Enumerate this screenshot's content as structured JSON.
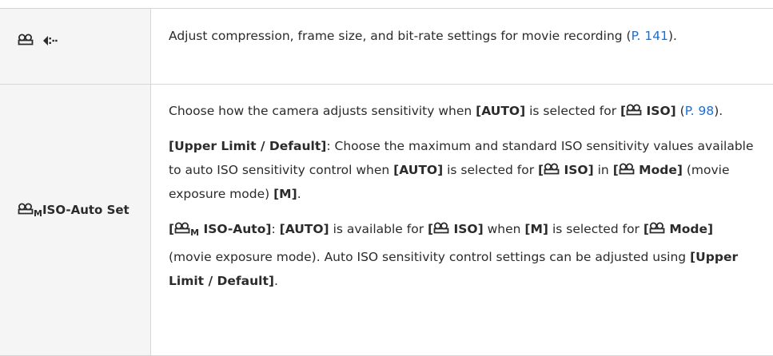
{
  "rows": [
    {
      "label_icons": [
        "movie-icon",
        "compression-icon"
      ],
      "desc_before_link": "Adjust compression, frame size, and bit-rate settings for movie recording (",
      "link": "P. 141",
      "desc_after_link": ")."
    },
    {
      "label_sub": "M",
      "label_text": "ISO-Auto Set",
      "p1": {
        "t1": "Choose how the camera adjusts sensitivity when ",
        "b1": "[AUTO]",
        "t2": " is selected for ",
        "b2_open": "[",
        "b2_text": " ISO]",
        "t3": " (",
        "link": "P. 98",
        "t4": ")."
      },
      "p2": {
        "b1": "[Upper Limit / Default]",
        "t1": ": Choose the maximum and standard ISO sensitivity values available to auto ISO sensitivity control when ",
        "b2": "[AUTO]",
        "t2": " is selected for ",
        "b3_open": "[",
        "b3_text": " ISO]",
        "t3": " in ",
        "b4_open": "[",
        "b4_text": " Mode]",
        "t4": " (movie exposure mode) ",
        "b5": "[M]",
        "t5": "."
      },
      "p3": {
        "b1_open": "[",
        "b1_sub": "M",
        "b1_text": " ISO-Auto]",
        "t1": ": ",
        "b2": "[AUTO]",
        "t2": " is available for ",
        "b3_open": "[",
        "b3_text": " ISO]",
        "t3": " when ",
        "b4": "[M]",
        "t4": " is selected for ",
        "b5_open": "[",
        "b5_text": " Mode]",
        "t5": " (movie exposure mode). Auto ISO sensitivity control settings can be adjusted using ",
        "b6": "[Upper Limit / Default]",
        "t6": "."
      }
    }
  ],
  "colors": {
    "link": "#1a6fd6",
    "label_bg": "#f5f5f5",
    "border": "#d6d6d6",
    "text": "#2b2b2b"
  }
}
